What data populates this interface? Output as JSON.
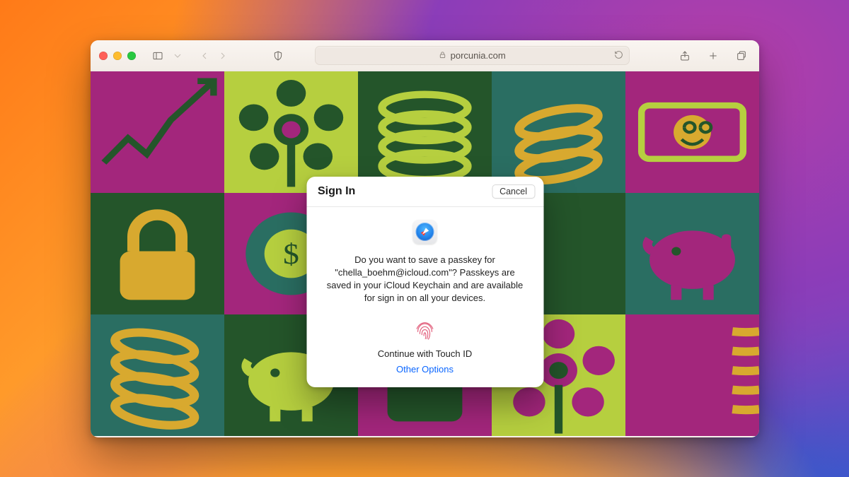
{
  "address_bar": {
    "domain": "porcunia.com"
  },
  "dialog": {
    "title": "Sign In",
    "cancel_label": "Cancel",
    "message": "Do you want to save a passkey for \"chella_boehm@icloud.com\"? Passkeys are saved in your iCloud Keychain and are available for sign in on all your devices.",
    "touch_id_label": "Continue with Touch ID",
    "other_options_label": "Other Options"
  },
  "colors": {
    "tile_green": "#24552a",
    "tile_lime": "#b6cf3f",
    "tile_magenta": "#a3267c",
    "tile_teal": "#2a6e62",
    "tile_gold": "#d8a92f",
    "link_blue": "#0a66ff"
  }
}
